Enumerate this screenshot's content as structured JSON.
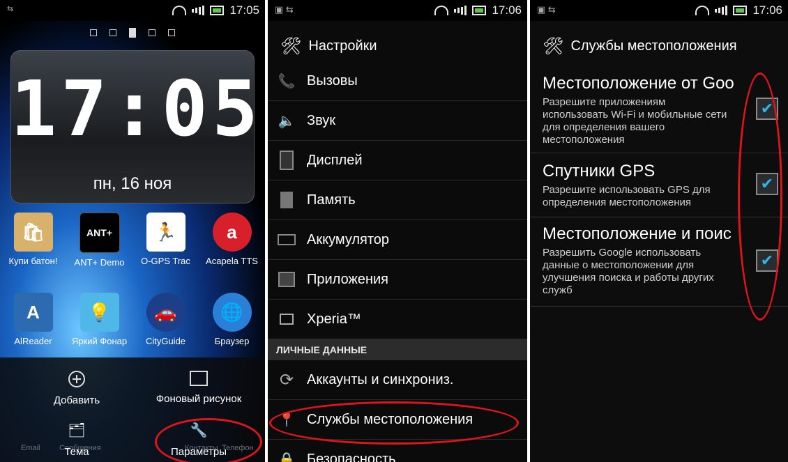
{
  "panel1": {
    "status_time": "17:05",
    "clock": {
      "time": "17:05",
      "date": "пн, 16 ноя"
    },
    "apps_row1": [
      {
        "label": "Купи батон!",
        "icon": "grocery-bag-icon"
      },
      {
        "label": "ANT+ Demo",
        "icon": "ant-plus-icon"
      },
      {
        "label": "O-GPS Trac",
        "icon": "runner-icon"
      },
      {
        "label": "Acapela TTS",
        "icon": "acapela-icon"
      }
    ],
    "apps_row2": [
      {
        "label": "AlReader",
        "icon": "alreader-icon"
      },
      {
        "label": "Яркий Фонар",
        "icon": "flashlight-icon"
      },
      {
        "label": "CityGuide",
        "icon": "cityguide-icon"
      },
      {
        "label": "Браузер",
        "icon": "globe-icon"
      }
    ],
    "menu": {
      "add": "Добавить",
      "wallpaper": "Фоновый рисунок",
      "theme": "Тема",
      "settings": "Параметры"
    },
    "dock_ghost": [
      "Email",
      "Сообщения",
      "Контакты",
      "Телефон"
    ]
  },
  "panel2": {
    "status_time": "17:06",
    "title": "Настройки",
    "items": [
      {
        "label": "Вызовы",
        "icon": "phone-icon"
      },
      {
        "label": "Звук",
        "icon": "speaker-icon"
      },
      {
        "label": "Дисплей",
        "icon": "display-icon"
      },
      {
        "label": "Память",
        "icon": "sdcard-icon"
      },
      {
        "label": "Аккумулятор",
        "icon": "battery-icon"
      },
      {
        "label": "Приложения",
        "icon": "apps-icon"
      },
      {
        "label": "Xperia™",
        "icon": "xperia-icon"
      }
    ],
    "section": "ЛИЧНЫЕ ДАННЫЕ",
    "items2": [
      {
        "label": "Аккаунты и синхрониз.",
        "icon": "sync-icon"
      },
      {
        "label": "Службы местоположения",
        "icon": "location-pin-icon"
      },
      {
        "label": "Безопасность",
        "icon": "lock-icon"
      }
    ]
  },
  "panel3": {
    "status_time": "17:06",
    "title": "Службы местоположения",
    "options": [
      {
        "title": "Местоположение от Goo",
        "desc": "Разрешите приложениям использовать Wi-Fi и мобильные сети для определения вашего местоположения",
        "checked": true
      },
      {
        "title": "Спутники GPS",
        "desc": "Разрешите использовать GPS для определения местоположения",
        "checked": true
      },
      {
        "title": "Местоположение и поис",
        "desc": "Разрешить Google использовать данные о местоположении для улучшения поиска и работы других служб",
        "checked": true
      }
    ]
  },
  "colors": {
    "accent": "#33b5e5",
    "annotation": "#e0151b"
  }
}
